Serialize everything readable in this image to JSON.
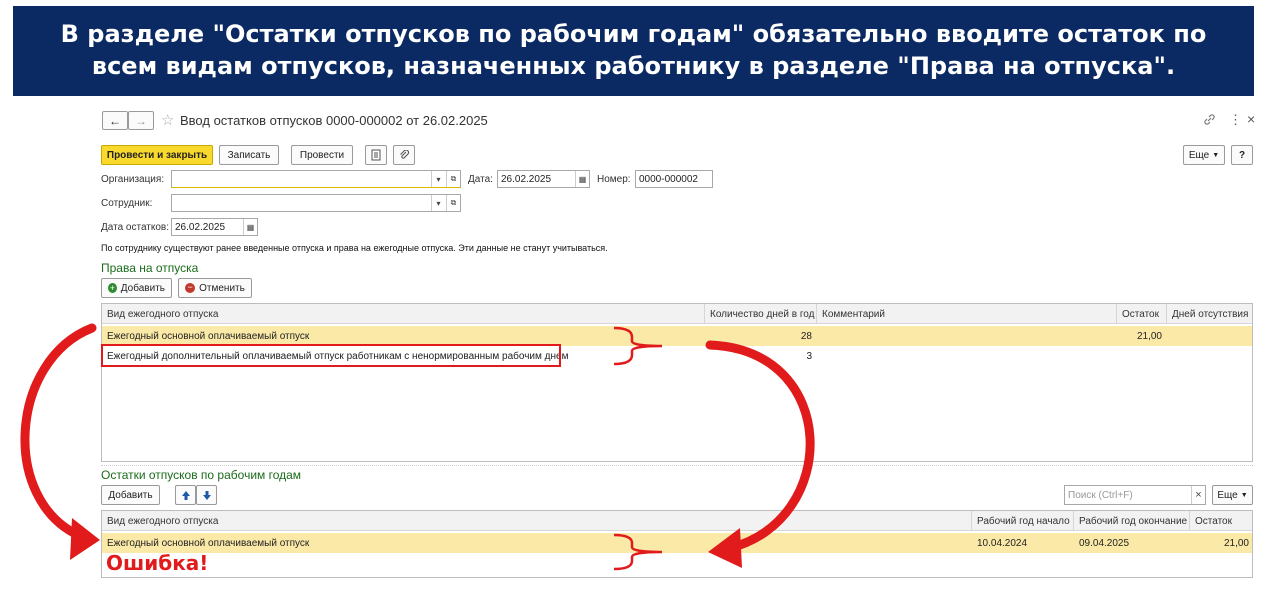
{
  "banner": {
    "line1": "В разделе \"Остатки отпусков по рабочим годам\" обязательно вводите остаток по",
    "line2": "всем видам отпусков, назначенных работнику в разделе \"Права на отпуска\"."
  },
  "window": {
    "title": "Ввод остатков отпусков 0000-000002 от 26.02.2025",
    "back": "←",
    "forward": "→",
    "star": "☆",
    "link_icon": "🔗",
    "menu_icon": "⋮",
    "close_icon": "×"
  },
  "toolbar": {
    "post_close": "Провести и закрыть",
    "save": "Записать",
    "post": "Провести",
    "more": "Еще",
    "help": "?"
  },
  "form": {
    "org_label": "Организация:",
    "org_value": "",
    "date_label": "Дата:",
    "date_value": "26.02.2025",
    "number_label": "Номер:",
    "number_value": "0000-000002",
    "employee_label": "Сотрудник:",
    "employee_value": "",
    "balance_date_label": "Дата остатков:",
    "balance_date_value": "26.02.2025",
    "notice": "По сотруднику существуют ранее введенные отпуска и права на ежегодные отпуска. Эти данные не станут учитываться."
  },
  "rights": {
    "title": "Права на отпуска",
    "add": "Добавить",
    "cancel": "Отменить",
    "columns": [
      "Вид ежегодного отпуска",
      "Количество дней в год",
      "Комментарий",
      "Остаток",
      "Дней отсутствия"
    ],
    "rows": [
      {
        "type": "Ежегодный основной оплачиваемый отпуск",
        "days": "28",
        "comment": "",
        "balance": "21,00",
        "absence": ""
      },
      {
        "type": "Ежегодный дополнительный оплачиваемый отпуск работникам с ненормированным рабочим днем",
        "days": "3",
        "comment": "",
        "balance": "",
        "absence": ""
      }
    ]
  },
  "balances": {
    "title": "Остатки отпусков по рабочим годам",
    "add": "Добавить",
    "up": "🡅",
    "down": "🡇",
    "search_placeholder": "Поиск (Ctrl+F)",
    "clear": "×",
    "more": "Еще",
    "columns": [
      "Вид ежегодного отпуска",
      "Рабочий год начало",
      "Рабочий год окончание",
      "Остаток"
    ],
    "rows": [
      {
        "type": "Ежегодный основной оплачиваемый отпуск",
        "start": "10.04.2024",
        "end": "09.04.2025",
        "balance": "21,00"
      }
    ]
  },
  "annotation": {
    "error": "Ошибка!",
    "color": "#e11b1b"
  }
}
